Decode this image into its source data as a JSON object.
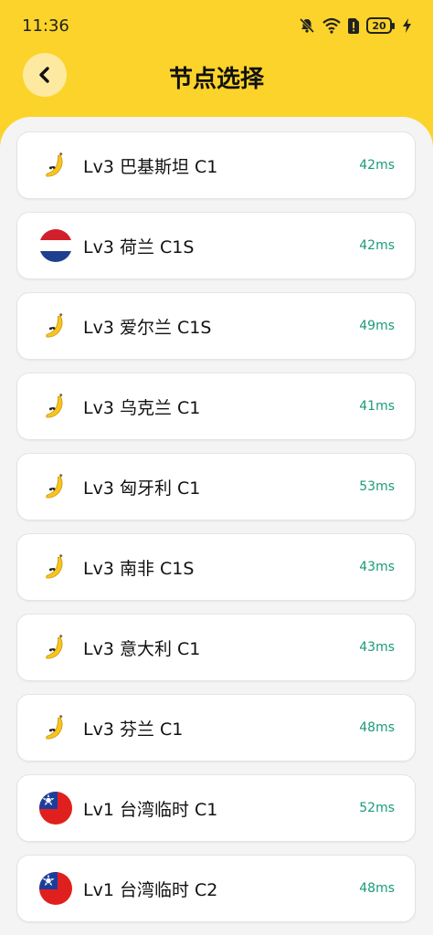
{
  "status": {
    "time": "11:36",
    "battery": "20"
  },
  "header": {
    "title": "节点选择"
  },
  "nodes": [
    {
      "name": "Lv3 巴基斯坦 C1",
      "ping": "42ms",
      "icon": "banana-icon"
    },
    {
      "name": "Lv3 荷兰 C1S",
      "ping": "42ms",
      "icon": "netherlands-flag-icon"
    },
    {
      "name": "Lv3 爱尔兰 C1S",
      "ping": "49ms",
      "icon": "banana-icon"
    },
    {
      "name": "Lv3 乌克兰 C1",
      "ping": "41ms",
      "icon": "banana-icon"
    },
    {
      "name": "Lv3 匈牙利 C1",
      "ping": "53ms",
      "icon": "banana-icon"
    },
    {
      "name": "Lv3 南非 C1S",
      "ping": "43ms",
      "icon": "banana-icon"
    },
    {
      "name": "Lv3 意大利 C1",
      "ping": "43ms",
      "icon": "banana-icon"
    },
    {
      "name": "Lv3 芬兰 C1",
      "ping": "48ms",
      "icon": "banana-icon"
    },
    {
      "name": "Lv1 台湾临时 C1",
      "ping": "52ms",
      "icon": "taiwan-flag-icon"
    },
    {
      "name": "Lv1 台湾临时 C2",
      "ping": "48ms",
      "icon": "taiwan-flag-icon"
    }
  ],
  "colors": {
    "header": "#fcd32a",
    "ping": "#1a9a7a",
    "background": "#f4f4f4"
  }
}
